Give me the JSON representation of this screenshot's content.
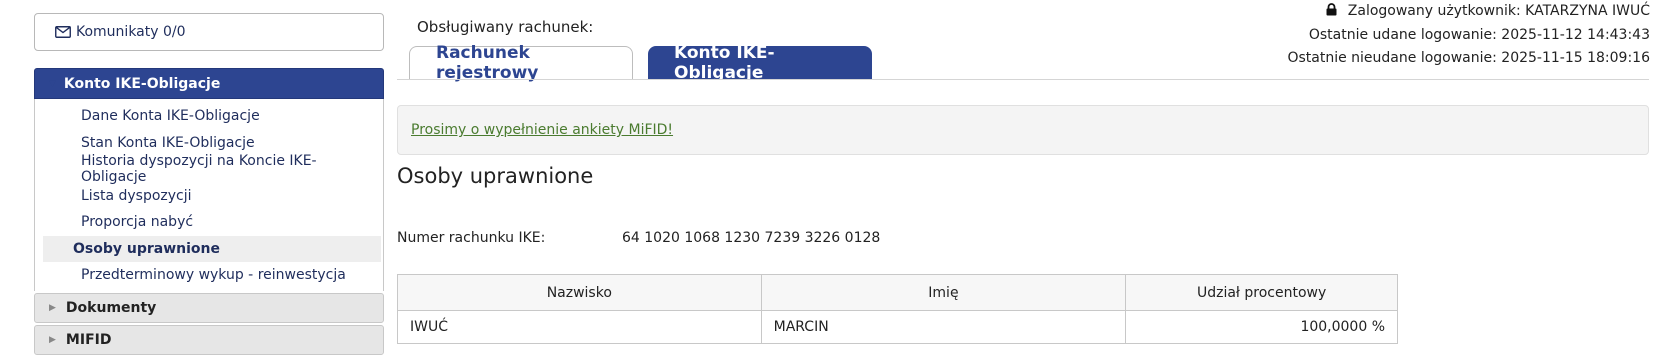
{
  "sidebar": {
    "messages_label": "Komunikaty 0/0",
    "active_section": {
      "label": "Konto IKE-Obligacje",
      "items": [
        {
          "label": "Dane Konta IKE-Obligacje"
        },
        {
          "label": "Stan Konta IKE-Obligacje"
        },
        {
          "label": "Historia dyspozycji na Koncie IKE-Obligacje"
        },
        {
          "label": "Lista dyspozycji"
        },
        {
          "label": "Proporcja nabyć"
        },
        {
          "label": "Osoby uprawnione"
        },
        {
          "label": "Przedterminowy wykup - reinwestycja"
        }
      ]
    },
    "sections": [
      {
        "label": "Dokumenty"
      },
      {
        "label": "MIFID"
      }
    ]
  },
  "header": {
    "served_account_label": "Obsługiwany rachunek:",
    "tabs": [
      {
        "label": "Rachunek rejestrowy"
      },
      {
        "label": "Konto IKE-Obligacje"
      }
    ]
  },
  "user": {
    "logged_label": "Zalogowany użytkownik:",
    "logged_name": "KATARZYNA IWUĆ",
    "last_success": "Ostatnie udane logowanie: 2025-11-12 14:43:43",
    "last_failed": "Ostatnie nieudane logowanie: 2025-11-15 18:09:16"
  },
  "notice": {
    "link_text": "Prosimy o wypełnienie ankiety MiFID!"
  },
  "main": {
    "title": "Osoby uprawnione",
    "account_label": "Numer rachunku IKE:",
    "account_number": "64 1020 1068 1230 7239 3226 0128",
    "table": {
      "headers": [
        "Nazwisko",
        "Imię",
        "Udział procentowy"
      ],
      "rows": [
        [
          "IWUĆ",
          "MARCIN",
          "100,0000 %"
        ]
      ]
    }
  },
  "colors": {
    "brand": "#2d4591",
    "link_green": "#4a7b2f"
  }
}
